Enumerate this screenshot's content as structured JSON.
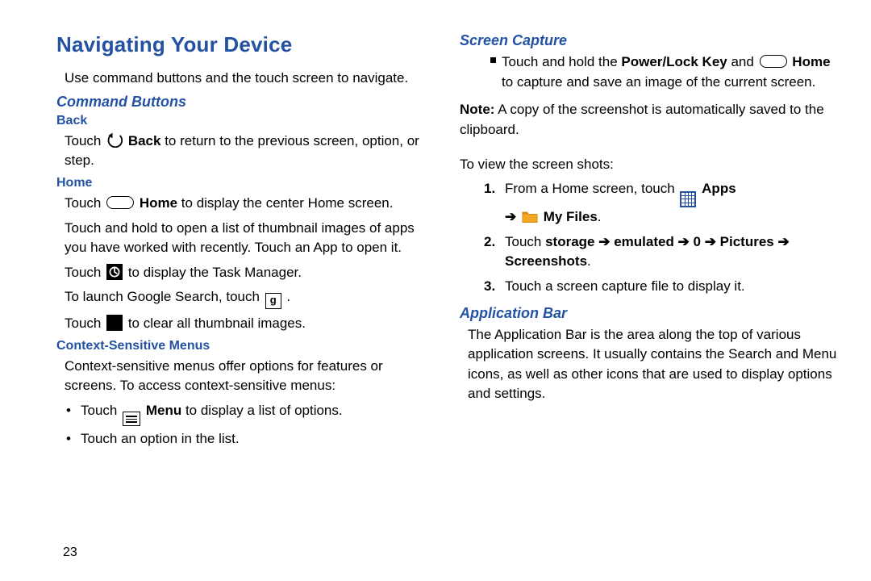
{
  "pageNumber": "23",
  "left": {
    "title": "Navigating Your Device",
    "intro": "Use command buttons and the touch screen to navigate.",
    "sec1": "Command Buttons",
    "back": {
      "heading": "Back",
      "l1a": "Touch ",
      "l1b": " Back",
      "l1c": " to return to the previous screen, option, or step."
    },
    "home": {
      "heading": "Home",
      "l1a": "Touch ",
      "l1b": " Home",
      "l1c": " to display the center Home screen.",
      "l2": "Touch and hold to open a list of thumbnail images of apps you have worked with recently. Touch an App to open it.",
      "l3a": "Touch ",
      "l3b": " to display the Task Manager.",
      "l4a": "To launch Google Search, touch ",
      "l4b": ".",
      "l5a": "Touch ",
      "l5b": " to clear all thumbnail images."
    },
    "ctx": {
      "heading": "Context-Sensitive Menus",
      "l1": "Context-sensitive menus offer options for features or screens. To access context-sensitive menus:",
      "b1a": "Touch ",
      "b1b": " Menu",
      "b1c": " to display a list of options.",
      "b2": "Touch an option in the list."
    }
  },
  "right": {
    "sc": {
      "heading": "Screen Capture",
      "b1a": "Touch and hold the ",
      "b1b": "Power/Lock Key",
      "b1c": " and ",
      "b1d": " Home",
      "b1e": " to capture and save an image of the current screen.",
      "noteLabel": "Note:",
      "noteText": " A copy of the screenshot is automatically saved to the clipboard.",
      "view": "To view the screen shots:",
      "s1a": "From a Home screen, touch ",
      "s1b": " Apps",
      "s1arrow": " ➔ ",
      "s1c": " My Files",
      "s1d": ".",
      "s2a": "Touch ",
      "s2b": "storage ➔ emulated ➔ 0 ➔ Pictures ➔ Screenshots",
      "s2c": ".",
      "s3": "Touch a screen capture file to display it."
    },
    "ab": {
      "heading": "Application Bar",
      "text": "The Application Bar is the area along the top of various application screens. It usually contains the Search and Menu icons, as well as other icons that are used to display options and settings."
    }
  },
  "nums": {
    "n1": "1.",
    "n2": "2.",
    "n3": "3."
  }
}
